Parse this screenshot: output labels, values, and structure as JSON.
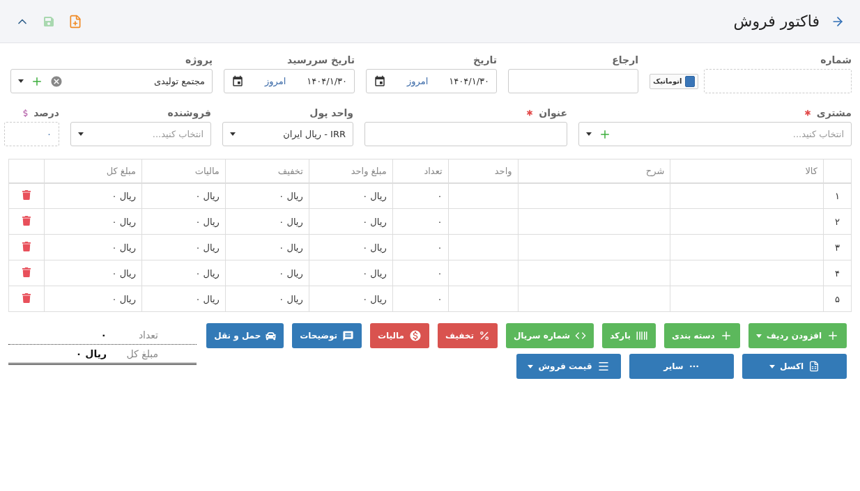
{
  "header": {
    "title": "فاکتور فروش"
  },
  "form_rows": [
    [
      {
        "kind": "number",
        "label": "شماره",
        "auto_label": "اتوماتیک",
        "auto_checked": true
      },
      {
        "kind": "text",
        "label": "ارجاع"
      },
      {
        "kind": "date",
        "label": "تاریخ",
        "value": "۱۴۰۴/۱/۳۰",
        "today": "امروز"
      },
      {
        "kind": "date",
        "label": "تاریخ سررسید",
        "value": "۱۴۰۴/۱/۳۰",
        "today": "امروز"
      },
      {
        "kind": "select",
        "label": "پروژه",
        "value": "مجتمع تولیدی",
        "clearable": true,
        "addable": true
      }
    ],
    [
      {
        "kind": "select",
        "label": "مشتری",
        "required": true,
        "placeholder": "انتخاب کنید...",
        "addable": true
      },
      {
        "kind": "text",
        "label": "عنوان",
        "required": true
      },
      {
        "kind": "select",
        "label": "واحد پول",
        "value": "IRR - ریال ایران"
      },
      {
        "kind": "select",
        "label": "فروشنده",
        "placeholder": "انتخاب کنید..."
      },
      {
        "kind": "percent",
        "label": "درصد",
        "value": "۰"
      }
    ]
  ],
  "table": {
    "columns": [
      "کالا",
      "شرح",
      "واحد",
      "تعداد",
      "مبلغ واحد",
      "تخفیف",
      "مالیات",
      "مبلغ کل"
    ],
    "rows": [
      {
        "index": "۱",
        "cells": [
          "",
          "",
          "",
          "۰",
          "ریال ۰",
          "ریال ۰",
          "ریال ۰",
          "ریال ۰"
        ]
      },
      {
        "index": "۲",
        "cells": [
          "",
          "",
          "",
          "۰",
          "ریال ۰",
          "ریال ۰",
          "ریال ۰",
          "ریال ۰"
        ]
      },
      {
        "index": "۳",
        "cells": [
          "",
          "",
          "",
          "۰",
          "ریال ۰",
          "ریال ۰",
          "ریال ۰",
          "ریال ۰"
        ]
      },
      {
        "index": "۴",
        "cells": [
          "",
          "",
          "",
          "۰",
          "ریال ۰",
          "ریال ۰",
          "ریال ۰",
          "ریال ۰"
        ]
      },
      {
        "index": "۵",
        "cells": [
          "",
          "",
          "",
          "۰",
          "ریال ۰",
          "ریال ۰",
          "ریال ۰",
          "ریال ۰"
        ]
      }
    ]
  },
  "toolbar_rows": [
    [
      {
        "label": "افزودن ردیف",
        "kind": "success",
        "dropdown": true
      },
      {
        "label": "دسته بندی",
        "kind": "success"
      },
      {
        "label": "بارکد",
        "kind": "success"
      },
      {
        "label": "شماره سریال",
        "kind": "success"
      },
      {
        "label": "تخفیف",
        "kind": "danger"
      },
      {
        "label": "مالیات",
        "kind": "danger"
      },
      {
        "label": "توضیحات",
        "kind": "primary"
      },
      {
        "label": "حمل و نقل",
        "kind": "primary"
      }
    ],
    [
      {
        "label": "اکسل",
        "kind": "primary",
        "dropdown": true
      },
      {
        "label": "سایر",
        "kind": "primary"
      },
      {
        "label": "قیمت فروش",
        "kind": "primary",
        "dropdown": true
      }
    ]
  ],
  "summary": [
    {
      "label": "تعداد",
      "value": "۰"
    },
    {
      "label": "مبلغ کل",
      "value": "ریال ۰"
    }
  ]
}
